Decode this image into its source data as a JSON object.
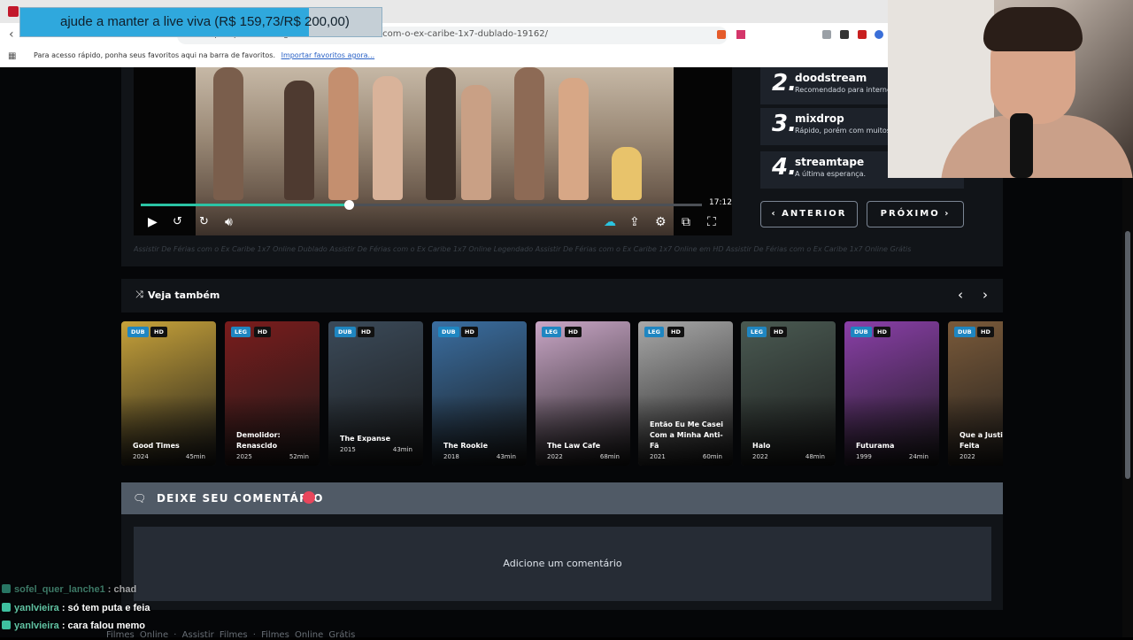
{
  "browser": {
    "url": "https://pobreflixtv.gura/assistir-de-ferias-com-o-ex-caribe-1x7-dublado-19162/",
    "bookmark_hint": "Para acesso rápido, ponha seus favoritos aqui na barra de favoritos.",
    "bookmark_import": "Importar favoritos agora..."
  },
  "donation": {
    "text": "ajude a manter a live viva (R$ 159,73/R$ 200,00)",
    "progress": 0.7987,
    "colors": {
      "fill": "#2fa8dd",
      "track": "#c5cfd6"
    }
  },
  "player": {
    "duration": "17:12",
    "progress": 0.37,
    "accent": "#2bc4a5"
  },
  "servers": [
    {
      "num": "2.",
      "name": "doodstream",
      "desc": "Recomendado para internet"
    },
    {
      "num": "3.",
      "name": "mixdrop",
      "desc": "Rápido, porém com muitos"
    },
    {
      "num": "4.",
      "name": "streamtape",
      "desc": "A última esperança."
    }
  ],
  "nav": {
    "prev": "ANTERIOR",
    "next": "PRÓXIMO"
  },
  "tagline": "Assistir De Férias com o Ex Caribe 1x7 Online Dublado Assistir De Férias com o Ex Caribe 1x7 Online Legendado Assistir De Férias com o Ex Caribe 1x7 Online em HD Assistir De Férias com o Ex Caribe 1x7 Online Grátis",
  "related": {
    "title": "Veja também",
    "items": [
      {
        "lang": "DUB",
        "quality": "HD",
        "title": "Good Times",
        "year": "2024",
        "duration": "45min",
        "color": "#c7a23a"
      },
      {
        "lang": "LEG",
        "quality": "HD",
        "title": "Demolidor: Renascido",
        "year": "2025",
        "duration": "52min",
        "color": "#7a1c1c"
      },
      {
        "lang": "DUB",
        "quality": "HD",
        "title": "The Expanse",
        "year": "2015",
        "duration": "43min",
        "color": "#3b4a59"
      },
      {
        "lang": "DUB",
        "quality": "HD",
        "title": "The Rookie",
        "year": "2018",
        "duration": "43min",
        "color": "#3a6ea1"
      },
      {
        "lang": "LEG",
        "quality": "HD",
        "title": "The Law Cafe",
        "year": "2022",
        "duration": "68min",
        "color": "#c9a6c6"
      },
      {
        "lang": "LEG",
        "quality": "HD",
        "title": "Então Eu Me Casei Com a Minha Anti-Fã",
        "year": "2021",
        "duration": "60min",
        "color": "#a8a8a8"
      },
      {
        "lang": "LEG",
        "quality": "HD",
        "title": "Halo",
        "year": "2022",
        "duration": "48min",
        "color": "#4a5a52"
      },
      {
        "lang": "DUB",
        "quality": "HD",
        "title": "Futurama",
        "year": "1999",
        "duration": "24min",
        "color": "#8a3fa8"
      },
      {
        "lang": "DUB",
        "quality": "HD",
        "title": "Que a Justiça Seja Feita",
        "year": "2022",
        "duration": "",
        "color": "#7a5a3a"
      }
    ]
  },
  "comments": {
    "title": "DEIXE SEU COMENTÁRIO",
    "placeholder": "Adicione um comentário"
  },
  "footer": "Filmes Online · Assistir Filmes · Filmes Online Grátis",
  "chat": [
    {
      "user": "sofel_quer_lanche1",
      "msg": ": chad"
    },
    {
      "user": "yanlvieira",
      "msg": ": só tem puta e feia"
    },
    {
      "user": "yanlvieira",
      "msg": ": cara falou memo"
    }
  ]
}
